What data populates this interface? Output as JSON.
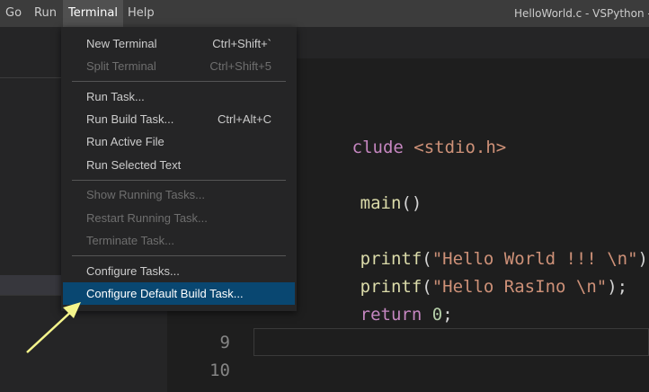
{
  "menubar": {
    "items": [
      "Go",
      "Run",
      "Terminal",
      "Help"
    ],
    "window_title": "HelloWorld.c - VSPython - V"
  },
  "terminal_menu": {
    "new_terminal": {
      "label": "New Terminal",
      "shortcut": "Ctrl+Shift+`"
    },
    "split_terminal": {
      "label": "Split Terminal",
      "shortcut": "Ctrl+Shift+5"
    },
    "run_task": {
      "label": "Run Task..."
    },
    "run_build_task": {
      "label": "Run Build Task...",
      "shortcut": "Ctrl+Alt+C"
    },
    "run_active_file": {
      "label": "Run Active File"
    },
    "run_selected_text": {
      "label": "Run Selected Text"
    },
    "show_running_tasks": {
      "label": "Show Running Tasks..."
    },
    "restart_running_task": {
      "label": "Restart Running Task..."
    },
    "terminate_task": {
      "label": "Terminate Task..."
    },
    "configure_tasks": {
      "label": "Configure Tasks..."
    },
    "configure_default_build_task": {
      "label": "Configure Default Build Task..."
    }
  },
  "editor": {
    "line1": {
      "directive": "clude",
      "header": "<stdio.h>"
    },
    "line3": {
      "func": "main",
      "parens": "()"
    },
    "line5": {
      "func": "printf",
      "open": "(",
      "string": "\"Hello World !!! \\n\"",
      "close": ");"
    },
    "line6": {
      "func": "printf",
      "open": "(",
      "string": "\"Hello RasIno \\n\"",
      "close": ");"
    },
    "line7": {
      "keyword": "return",
      "value": "0",
      "semi": ";"
    },
    "gutter_9": "9",
    "gutter_10": "10"
  },
  "colors": {
    "menu_highlight": "#094771",
    "arrow": "#f5f58c"
  }
}
